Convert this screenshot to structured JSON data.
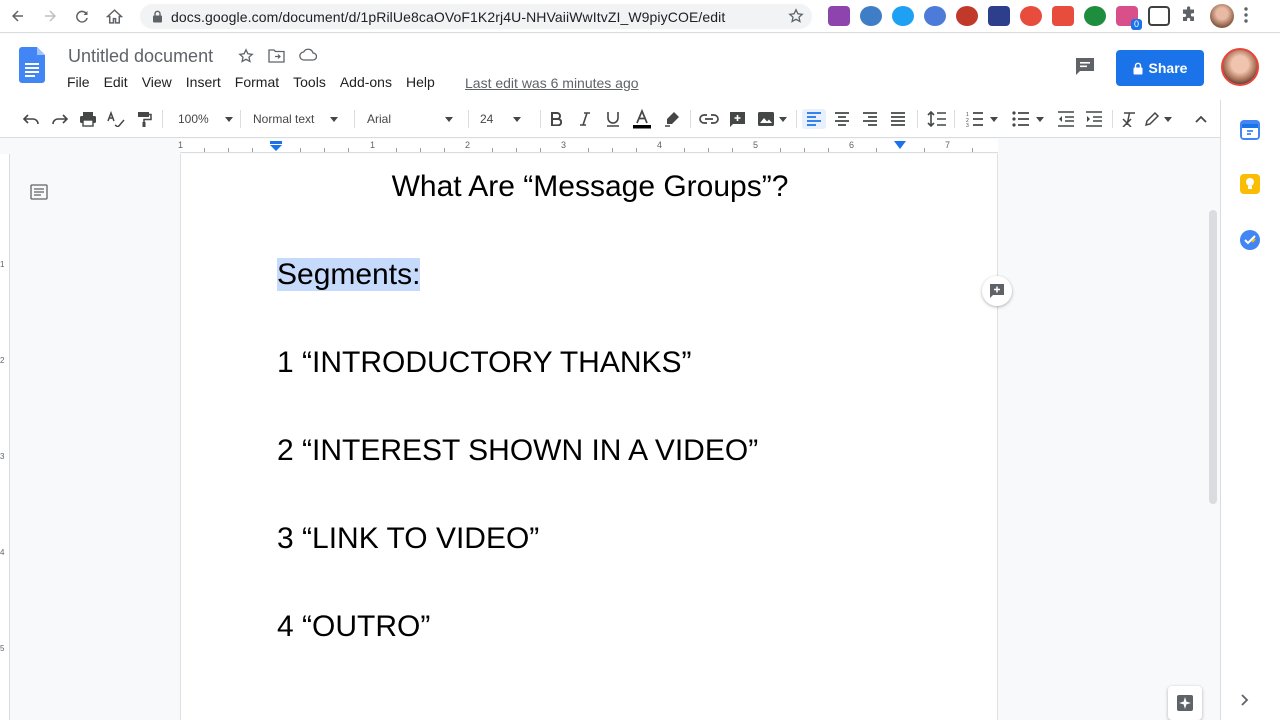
{
  "browser": {
    "url": "docs.google.com/document/d/1pRilUe8caOVoF1K2rj4U-NHVaiiWwItvZI_W9piyCOE/edit",
    "extension_badge": "0"
  },
  "header": {
    "doc_title": "Untitled document",
    "menu": [
      "File",
      "Edit",
      "View",
      "Insert",
      "Format",
      "Tools",
      "Add-ons",
      "Help"
    ],
    "last_edit": "Last edit was 6 minutes ago",
    "share_label": "Share"
  },
  "toolbar": {
    "zoom": "100%",
    "style": "Normal text",
    "font": "Arial",
    "font_size": "24"
  },
  "ruler": {
    "numbers": [
      "1",
      "1",
      "2",
      "3",
      "4",
      "5",
      "6",
      "7"
    ]
  },
  "vruler": {
    "numbers": [
      "1",
      "2",
      "3",
      "4",
      "5"
    ]
  },
  "document": {
    "heading": "What Are “Message Groups”?",
    "lines": [
      "Segments:",
      "1 “INTRODUCTORY THANKS”",
      "2 “INTEREST SHOWN IN A VIDEO”",
      "3 “LINK TO VIDEO”",
      "4 “OUTRO”"
    ]
  },
  "colors": {
    "accent": "#1a73e8",
    "selection": "#c6dafc"
  }
}
